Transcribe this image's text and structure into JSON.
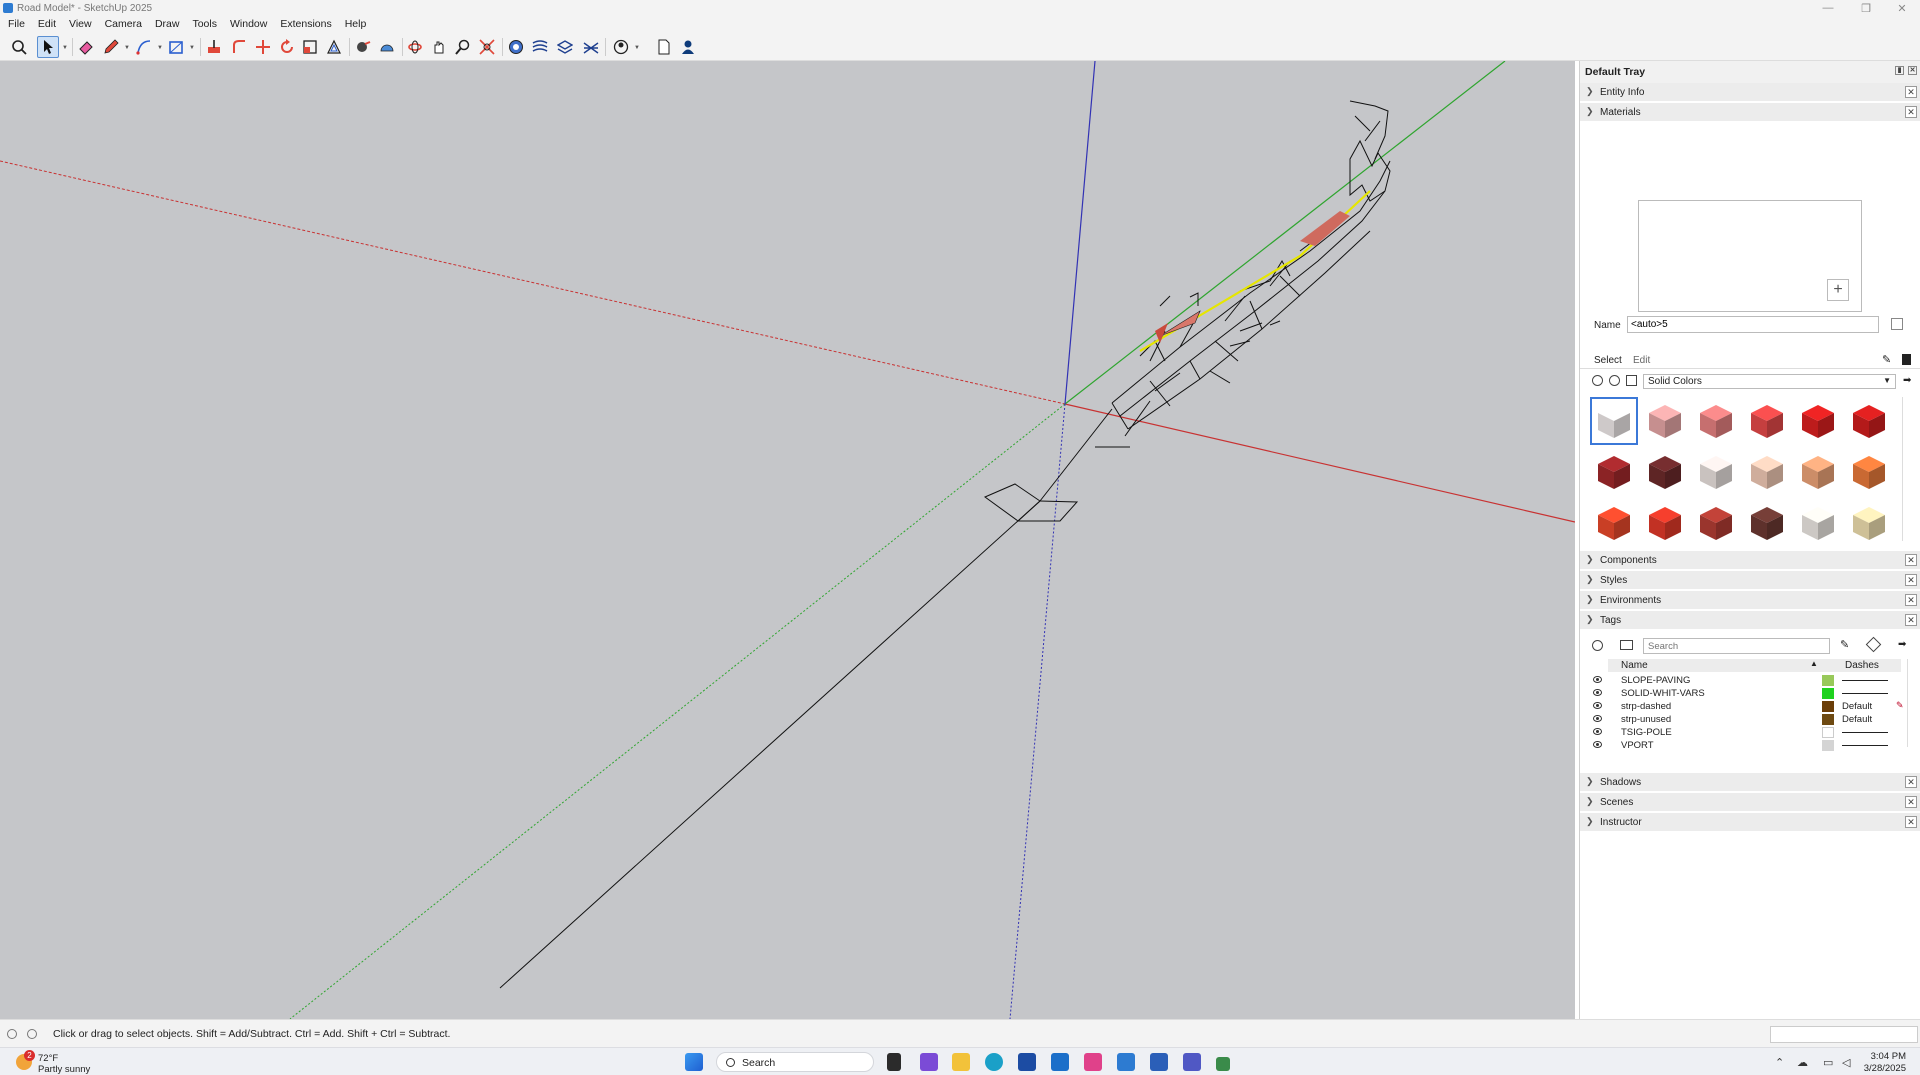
{
  "window": {
    "title": "Road Model* - SketchUp 2025",
    "minimize": "—",
    "restore": "❒",
    "close": "✕"
  },
  "menu": [
    "File",
    "Edit",
    "View",
    "Camera",
    "Draw",
    "Tools",
    "Window",
    "Extensions",
    "Help"
  ],
  "toolbar_icons": [
    "search-icon",
    "select-icon",
    "eraser-icon",
    "pencil-icon",
    "arc-icon",
    "rectangle-icon",
    "push-pull-icon",
    "follow-me-icon",
    "move-icon",
    "rotate-icon",
    "scale-icon",
    "offset-icon",
    "tape-measure-icon",
    "protractor-icon",
    "orbit-icon",
    "pan-icon",
    "zoom-icon",
    "zoom-extents-icon",
    "geo-location-icon",
    "sandbox-from-contours-icon",
    "sandbox-from-scratch-icon",
    "stamp-icon",
    "profile-icon",
    "new-file-icon",
    "account-icon"
  ],
  "tray": {
    "title": "Default Tray",
    "panels": {
      "entity_info": "Entity Info",
      "materials": "Materials",
      "components": "Components",
      "styles": "Styles",
      "environments": "Environments",
      "tags": "Tags",
      "shadows": "Shadows",
      "scenes": "Scenes",
      "instructor": "Instructor"
    }
  },
  "materials": {
    "name_label": "Name",
    "name_value": "<auto>5",
    "tab_select": "Select",
    "tab_edit": "Edit",
    "library": "Solid Colors",
    "swatches": [
      "#f2ecec",
      "#e9a8a8",
      "#e98282",
      "#e84a4a",
      "#de2121",
      "#d41f1f",
      "#a4292c",
      "#6e2b2c",
      "#ece4e1",
      "#f4ccb7",
      "#f0a67a",
      "#ec7c3c",
      "#ec4a2c",
      "#e43a2a",
      "#b53e35",
      "#6e3a34",
      "#f0ebe6",
      "#f2e2b2"
    ]
  },
  "tags": {
    "search_placeholder": "Search",
    "col_name": "Name",
    "col_dashes": "Dashes",
    "sort_glyph": "▲",
    "rows": [
      {
        "name": "SLOPE-PAVING",
        "color": "#98c95a",
        "dashes": ""
      },
      {
        "name": "SOLID-WHIT-VARS",
        "color": "#1ed21e",
        "dashes": ""
      },
      {
        "name": "strp-dashed",
        "color": "#6b3e08",
        "dashes": "Default"
      },
      {
        "name": "strp-unused",
        "color": "#6e4a12",
        "dashes": "Default"
      },
      {
        "name": "TSIG-POLE",
        "color": "#ffffff",
        "dashes": ""
      },
      {
        "name": "VPORT",
        "color": "#d4d4d4",
        "dashes": ""
      }
    ]
  },
  "status": {
    "message": "Click or drag to select objects. Shift = Add/Subtract. Ctrl = Add. Shift + Ctrl = Subtract."
  },
  "taskbar": {
    "weather_temp": "72°F",
    "weather_cond": "Partly sunny",
    "weather_badge": "2",
    "search": "Search",
    "time": "3:04 PM",
    "date": "3/28/2025"
  },
  "colors": {
    "viewport_bg": "#c5c6c9",
    "axis_red": "#c83232",
    "axis_green": "#2fa52f",
    "axis_blue": "#3232b4",
    "selection_blue": "#3b78d8"
  }
}
